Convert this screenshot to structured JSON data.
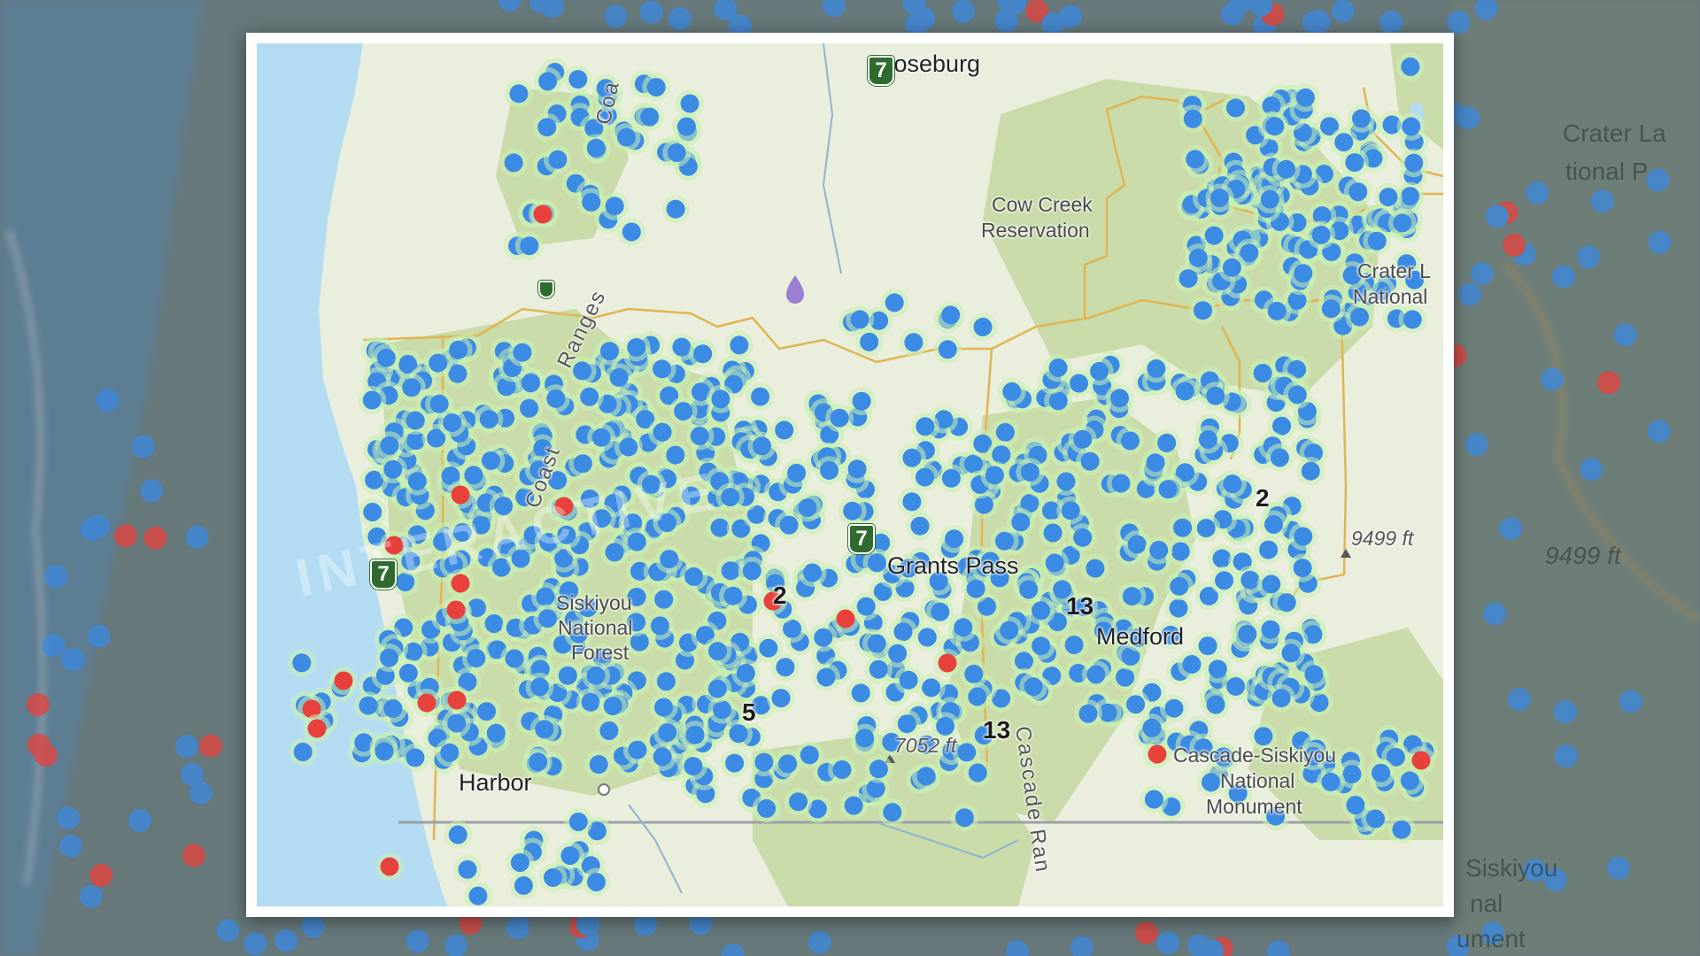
{
  "labels": {
    "roseburg": "Roseburg",
    "coast_range_top": "Coa",
    "cow_creek": "Cow Creek",
    "reservation": "Reservation",
    "crater_lake": "Crater L",
    "crater_lake_national": "National",
    "coast_ranges": "Ranges",
    "coast_word": "Coast",
    "grants_pass": "Grants Pass",
    "siskiyou_1": "Siskiyou",
    "siskiyou_2": "National",
    "siskiyou_3": "Forest",
    "medford": "Medford",
    "harbor": "Harbor",
    "elev_9499": "9499 ft",
    "elev_7052": "7052 ft",
    "cascade_siskiyou_1": "Cascade-Siskiyou",
    "cascade_siskiyou_2": "National",
    "cascade_siskiyou_3": "Monument",
    "cascade_range": "Cascade Ran",
    "watermark": "INTERACTIVE"
  },
  "background_labels": {
    "crater_la": "Crater La",
    "tional": "tional P",
    "elev": "9499 ft",
    "siskiyou": "Siskiyou",
    "nal": "nal",
    "ument": "ument"
  },
  "cluster_counts": {
    "c1": "2",
    "c2": "2",
    "c3": "13",
    "c4": "5",
    "c5": "13"
  },
  "route_shields": {
    "s1": "7",
    "s2": "7",
    "s3": "7",
    "s4": "7"
  },
  "colors": {
    "water": "#b3dcf3",
    "land": "#eaeedd",
    "forest": "#c9dba8",
    "marker_blue": "#3b8ae3",
    "marker_red": "#e8413c",
    "marker_halo": "#c9f0b2",
    "boundary": "#e0b552"
  }
}
